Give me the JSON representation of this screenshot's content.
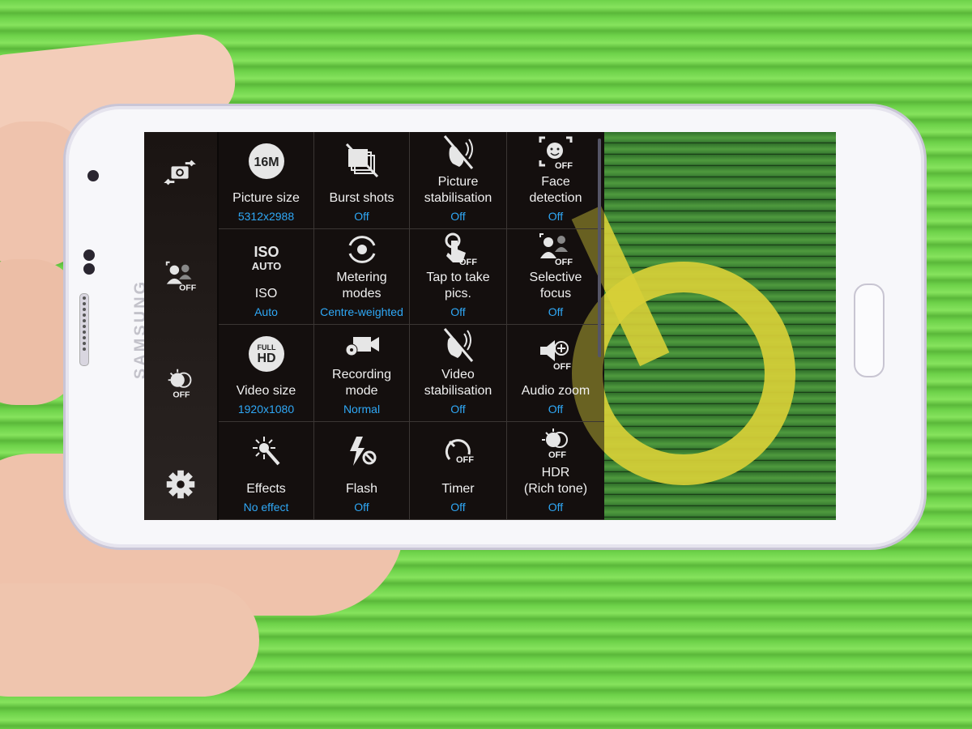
{
  "device": {
    "brand": "SAMSUNG"
  },
  "colors": {
    "value_text": "#2fa8f6",
    "label_text": "#f0f0f0",
    "panel_bg": "#0b0807"
  },
  "sidebar": {
    "items": [
      {
        "name": "switch-camera",
        "icon": "camera-switch-icon"
      },
      {
        "name": "selective-focus-shortcut",
        "icon": "selective-focus-off-icon",
        "badge": "OFF"
      },
      {
        "name": "hdr-shortcut",
        "icon": "hdr-off-icon",
        "badge": "OFF"
      },
      {
        "name": "settings",
        "icon": "gear-icon"
      }
    ]
  },
  "settings": [
    {
      "icon": "16m-icon",
      "icon_text": "16M",
      "label": "Picture size",
      "value": "5312x2988"
    },
    {
      "icon": "burst-off-icon",
      "label": "Burst shots",
      "value": "Off"
    },
    {
      "icon": "stabilisation-off-icon",
      "label": "Picture\nstabilisation",
      "value": "Off"
    },
    {
      "icon": "face-detection-off-icon",
      "badge": "OFF",
      "label": "Face\ndetection",
      "value": "Off"
    },
    {
      "icon": "iso-auto-icon",
      "icon_text": "ISO",
      "icon_sub": "AUTO",
      "label": "ISO",
      "value": "Auto"
    },
    {
      "icon": "metering-icon",
      "label": "Metering\nmodes",
      "value": "Centre-weighted"
    },
    {
      "icon": "tap-off-icon",
      "badge": "OFF",
      "label": "Tap to take\npics.",
      "value": "Off"
    },
    {
      "icon": "selective-focus-off-icon",
      "badge": "OFF",
      "label": "Selective\nfocus",
      "value": "Off"
    },
    {
      "icon": "full-hd-icon",
      "icon_text": "HD",
      "icon_sub": "FULL",
      "label": "Video size",
      "value": "1920x1080"
    },
    {
      "icon": "recording-mode-icon",
      "label": "Recording\nmode",
      "value": "Normal"
    },
    {
      "icon": "video-stabilisation-off-icon",
      "label": "Video\nstabilisation",
      "value": "Off"
    },
    {
      "icon": "audio-zoom-off-icon",
      "badge": "OFF",
      "label": "Audio zoom",
      "value": "Off"
    },
    {
      "icon": "effects-icon",
      "label": "Effects",
      "value": "No effect"
    },
    {
      "icon": "flash-off-icon",
      "label": "Flash",
      "value": "Off"
    },
    {
      "icon": "timer-off-icon",
      "badge": "OFF",
      "label": "Timer",
      "value": "Off"
    },
    {
      "icon": "hdr-off-icon",
      "badge": "OFF",
      "label": "HDR\n(Rich tone)",
      "value": "Off"
    }
  ]
}
